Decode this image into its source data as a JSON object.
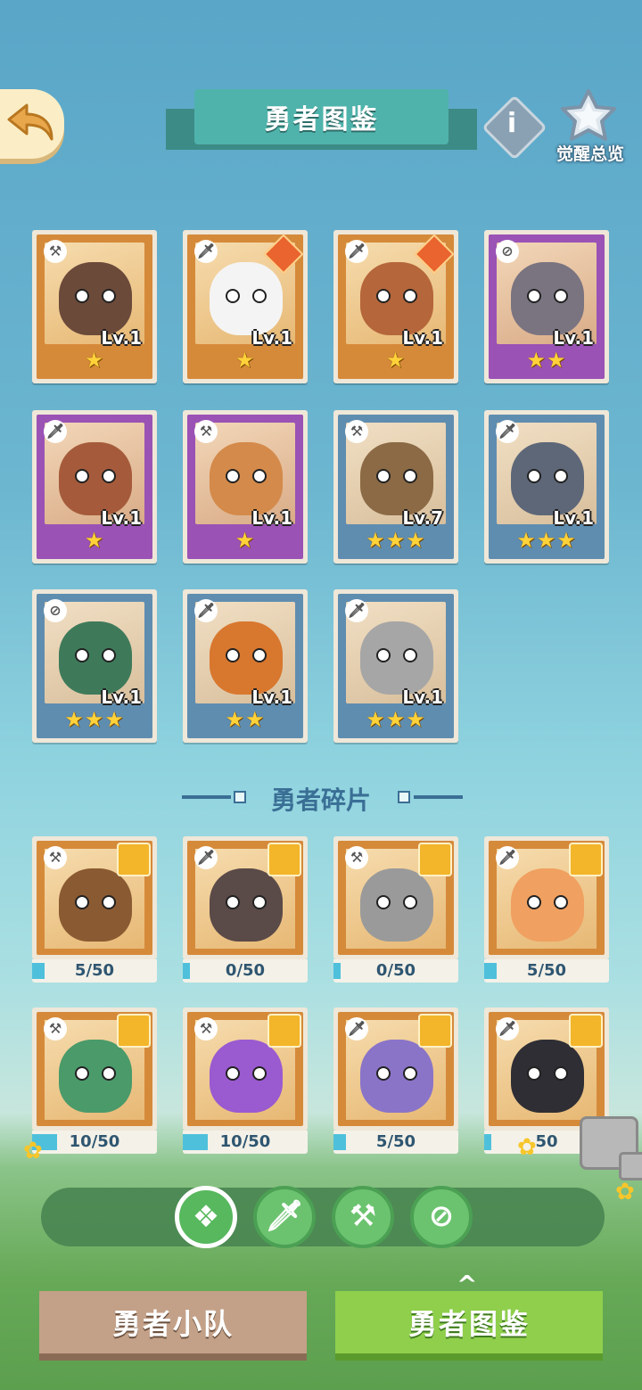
{
  "header": {
    "title": "勇者图鉴",
    "awaken_label": "觉醒总览",
    "info_label": "i"
  },
  "heroes": [
    {
      "level": "Lv.1",
      "stars": "★",
      "rarity": "orange",
      "role_icon": "hammer-icon",
      "fur": "#6b4a3a"
    },
    {
      "level": "Lv.1",
      "stars": "★",
      "rarity": "orange",
      "role_icon": "sword-icon",
      "fur": "#f4f4f4"
    },
    {
      "level": "Lv.1",
      "stars": "★",
      "rarity": "orange",
      "role_icon": "sword-icon",
      "fur": "#b5663a"
    },
    {
      "level": "Lv.1",
      "stars": "★★",
      "rarity": "purple",
      "role_icon": "compass-icon",
      "fur": "#7a7380"
    },
    {
      "level": "Lv.1",
      "stars": "★",
      "rarity": "purple",
      "role_icon": "sword-icon",
      "fur": "#a55b3b"
    },
    {
      "level": "Lv.1",
      "stars": "★",
      "rarity": "purple",
      "role_icon": "hammer-icon",
      "fur": "#d48a4a"
    },
    {
      "level": "Lv.7",
      "stars": "★★★",
      "rarity": "blue",
      "role_icon": "hammer-icon",
      "fur": "#8b6a45"
    },
    {
      "level": "Lv.1",
      "stars": "★★★",
      "rarity": "blue",
      "role_icon": "sword-icon",
      "fur": "#5d6778"
    },
    {
      "level": "Lv.1",
      "stars": "★★★",
      "rarity": "blue",
      "role_icon": "compass-icon",
      "fur": "#3e7a5a"
    },
    {
      "level": "Lv.1",
      "stars": "★★",
      "rarity": "blue",
      "role_icon": "sword-icon",
      "fur": "#d8772e"
    },
    {
      "level": "Lv.1",
      "stars": "★★★",
      "rarity": "blue",
      "role_icon": "sword-icon",
      "fur": "#a6a6a6"
    }
  ],
  "fragments_section": {
    "title": "勇者碎片"
  },
  "fragments": [
    {
      "progress": "5/50",
      "fill_fraction": 0.1,
      "role_icon": "hammer-icon",
      "fur": "#8a5a32"
    },
    {
      "progress": "0/50",
      "fill_fraction": 0.0,
      "role_icon": "sword-icon",
      "fur": "#5a4a48"
    },
    {
      "progress": "0/50",
      "fill_fraction": 0.0,
      "role_icon": "hammer-icon",
      "fur": "#9a9a9a"
    },
    {
      "progress": "5/50",
      "fill_fraction": 0.1,
      "role_icon": "sword-icon",
      "fur": "#f0a060"
    },
    {
      "progress": "10/50",
      "fill_fraction": 0.2,
      "role_icon": "hammer-icon",
      "fur": "#4a9a6a"
    },
    {
      "progress": "10/50",
      "fill_fraction": 0.2,
      "role_icon": "hammer-icon",
      "fur": "#9a5ad0"
    },
    {
      "progress": "5/50",
      "fill_fraction": 0.1,
      "role_icon": "sword-icon",
      "fur": "#8a74c8"
    },
    {
      "progress": "50",
      "fill_fraction": 0.0,
      "role_icon": "sword-icon",
      "fur": "#2e2e34"
    }
  ],
  "filters": [
    {
      "icon": "all-diamond-icon",
      "glyph": "❖",
      "active": true
    },
    {
      "icon": "sword-icon",
      "glyph": "🗡",
      "active": false
    },
    {
      "icon": "hammer-icon",
      "glyph": "⚒",
      "active": false
    },
    {
      "icon": "compass-icon",
      "glyph": "⊘",
      "active": false
    }
  ],
  "bottom_nav": {
    "team_label": "勇者小队",
    "book_label": "勇者图鉴",
    "caret": "^"
  },
  "colors": {
    "banner": "#4fb3ab",
    "orange_card": "#d58a3a",
    "purple_card": "#9a52b5",
    "blue_card": "#5f8db0",
    "star": "#ffd23a",
    "nav_active": "#8fcf4c",
    "nav_inactive": "#c3a188"
  }
}
